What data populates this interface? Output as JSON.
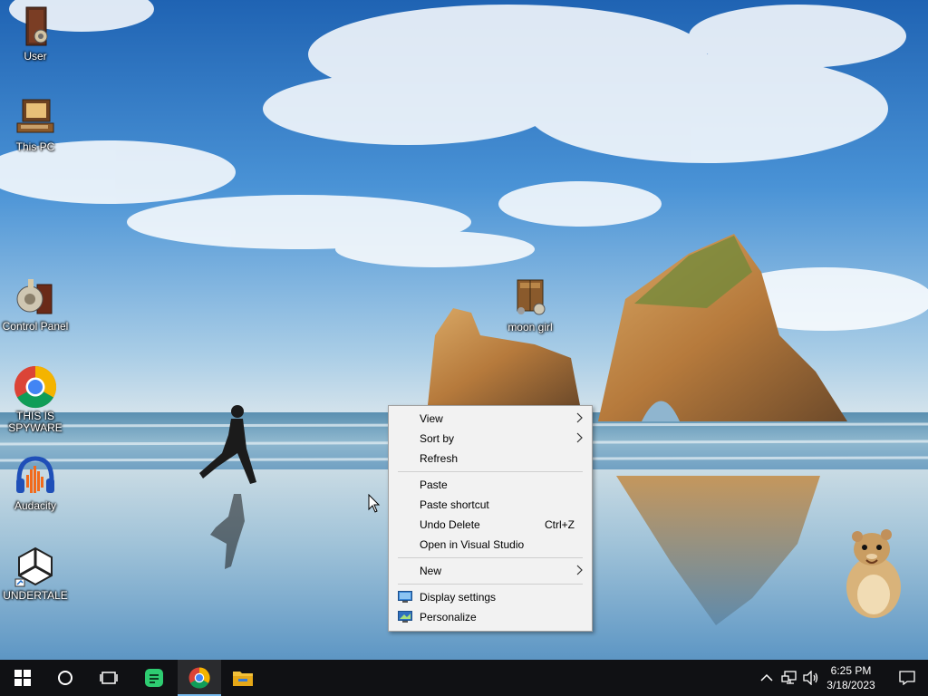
{
  "desktop": {
    "icons": [
      {
        "label": "User",
        "icon": "user-folder-icon"
      },
      {
        "label": "This PC",
        "icon": "computer-icon"
      },
      {
        "label": "Control Panel",
        "icon": "control-panel-icon"
      },
      {
        "label": "THIS IS SPYWARE",
        "icon": "chrome-icon"
      },
      {
        "label": "Audacity",
        "icon": "audacity-icon"
      },
      {
        "label": "UNDERTALE",
        "icon": "unity-icon"
      },
      {
        "label": "moon girl",
        "icon": "folder-icon"
      }
    ]
  },
  "context_menu": {
    "view": "View",
    "sort_by": "Sort by",
    "refresh": "Refresh",
    "paste": "Paste",
    "paste_shortcut": "Paste shortcut",
    "undo_delete": "Undo Delete",
    "undo_delete_shortcut": "Ctrl+Z",
    "open_visual_studio": "Open in Visual Studio",
    "new": "New",
    "display_settings": "Display settings",
    "personalize": "Personalize"
  },
  "taskbar": {
    "buttons": [
      "start-icon",
      "search-icon",
      "task-view-icon",
      "notes-app-icon",
      "chrome-icon",
      "file-explorer-icon"
    ],
    "time": "6:25 PM",
    "date": "3/18/2023",
    "accent_color": "#76b9ed"
  }
}
